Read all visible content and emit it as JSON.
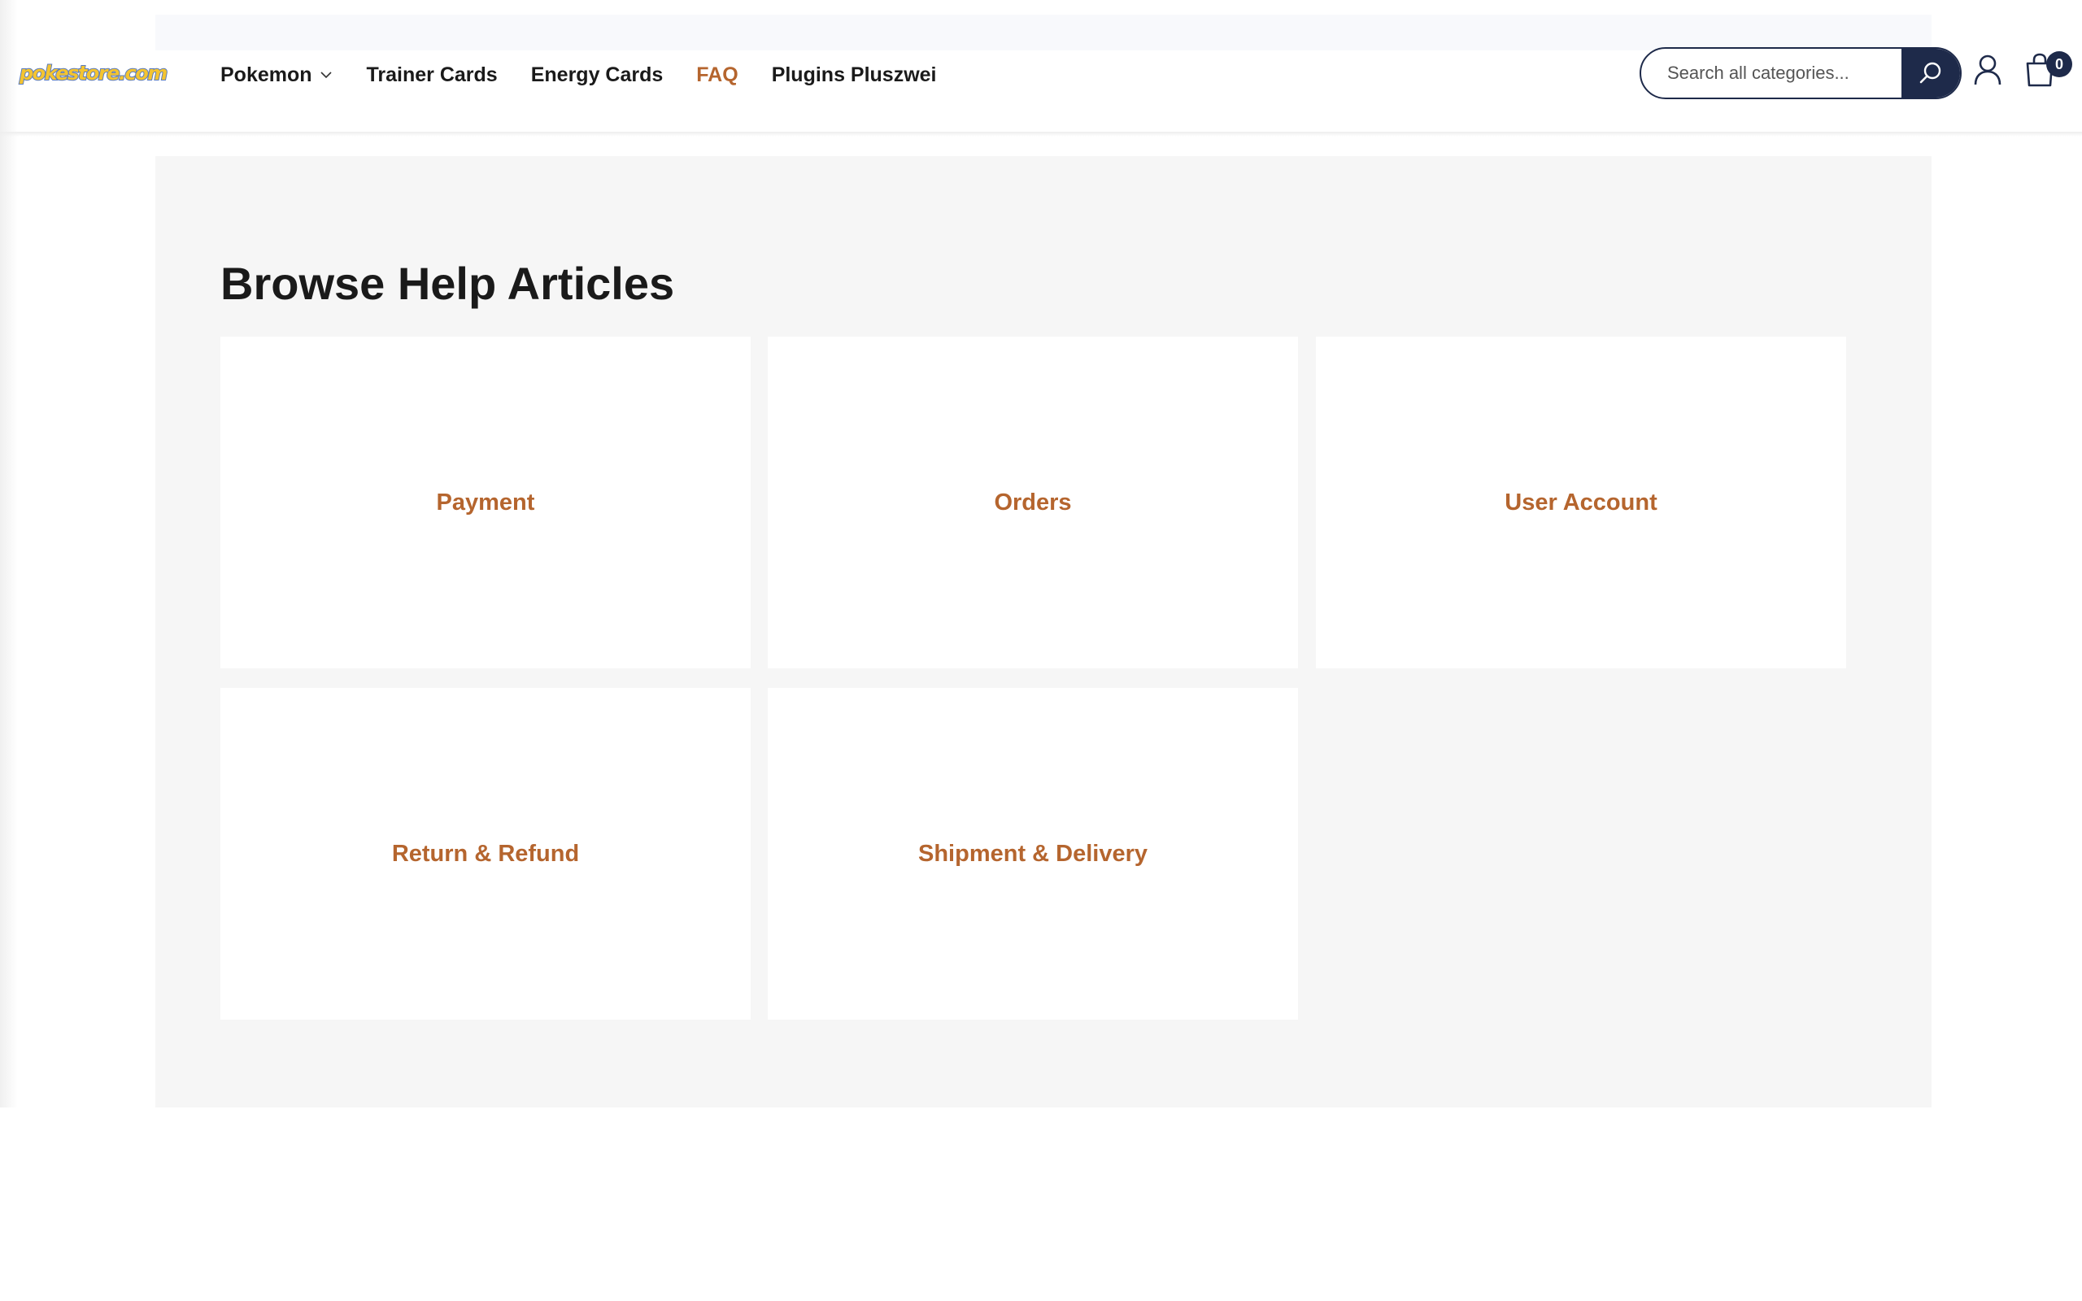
{
  "header": {
    "logo_text": "pokestore.com",
    "nav": [
      {
        "label": "Pokemon"
      },
      {
        "label": "Trainer Cards"
      },
      {
        "label": "Energy Cards"
      },
      {
        "label": "FAQ"
      },
      {
        "label": "Plugins Pluszwei"
      }
    ],
    "search": {
      "placeholder": "Search all categories...",
      "value": ""
    },
    "cart_count": "0"
  },
  "colors": {
    "accent": "#b5652e",
    "navy": "#1e2a4a",
    "panel_bg": "#f6f6f6"
  },
  "icons": {
    "search": "search-icon",
    "user": "user-icon",
    "cart": "shopping-bag-icon",
    "chevron": "chevron-down-icon"
  },
  "main": {
    "title": "Browse Help Articles",
    "categories": [
      {
        "label": "Payment"
      },
      {
        "label": "Orders"
      },
      {
        "label": "User Account"
      },
      {
        "label": "Return & Refund"
      },
      {
        "label": "Shipment & Delivery"
      }
    ]
  }
}
